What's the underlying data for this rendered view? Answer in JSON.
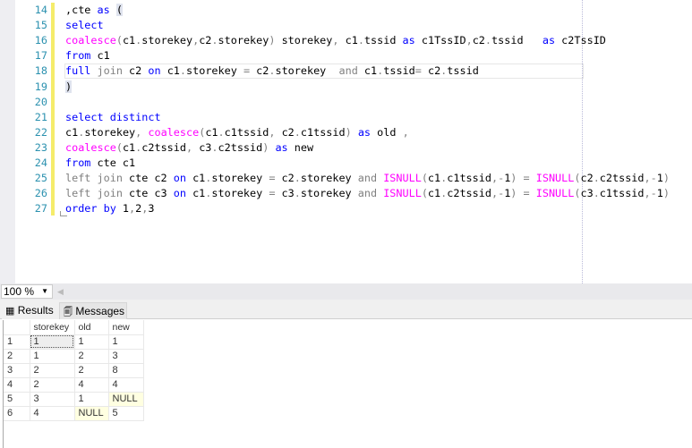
{
  "editor": {
    "lines": [
      {
        "n": "14",
        "tokens": [
          [
            "p",
            ",cte "
          ],
          [
            "k",
            "as"
          ],
          [
            "p",
            " "
          ],
          [
            "h",
            "("
          ]
        ]
      },
      {
        "n": "15",
        "tokens": [
          [
            "k",
            "select"
          ]
        ]
      },
      {
        "n": "16",
        "tokens": [
          [
            "f",
            "coalesce"
          ],
          [
            "g",
            "("
          ],
          [
            "p",
            "c1"
          ],
          [
            "g",
            "."
          ],
          [
            "p",
            "storekey"
          ],
          [
            "g",
            ","
          ],
          [
            "p",
            "c2"
          ],
          [
            "g",
            "."
          ],
          [
            "p",
            "storekey"
          ],
          [
            "g",
            ")"
          ],
          [
            "p",
            " storekey"
          ],
          [
            "g",
            ","
          ],
          [
            "p",
            " c1"
          ],
          [
            "g",
            "."
          ],
          [
            "p",
            "tssid "
          ],
          [
            "k",
            "as"
          ],
          [
            "p",
            " c1TssID"
          ],
          [
            "g",
            ","
          ],
          [
            "p",
            "c2"
          ],
          [
            "g",
            "."
          ],
          [
            "p",
            "tssid   "
          ],
          [
            "k",
            "as"
          ],
          [
            "p",
            " c2TssID"
          ]
        ]
      },
      {
        "n": "17",
        "tokens": [
          [
            "k",
            "from"
          ],
          [
            "p",
            " c1"
          ]
        ]
      },
      {
        "n": "18",
        "tokens": [
          [
            "k",
            "full"
          ],
          [
            "p",
            " "
          ],
          [
            "g",
            "join"
          ],
          [
            "p",
            " c2 "
          ],
          [
            "k",
            "on"
          ],
          [
            "p",
            " c1"
          ],
          [
            "g",
            "."
          ],
          [
            "p",
            "storekey "
          ],
          [
            "g",
            "="
          ],
          [
            "p",
            " c2"
          ],
          [
            "g",
            "."
          ],
          [
            "p",
            "storekey  "
          ],
          [
            "g",
            "and"
          ],
          [
            "p",
            " c1"
          ],
          [
            "g",
            "."
          ],
          [
            "p",
            "tssid"
          ],
          [
            "g",
            "="
          ],
          [
            "p",
            " c2"
          ],
          [
            "g",
            "."
          ],
          [
            "p",
            "tssid"
          ]
        ]
      },
      {
        "n": "19",
        "tokens": [
          [
            "h",
            ")"
          ]
        ]
      },
      {
        "n": "20",
        "tokens": []
      },
      {
        "n": "21",
        "tokens": [
          [
            "k",
            "select"
          ],
          [
            "p",
            " "
          ],
          [
            "k",
            "distinct"
          ]
        ]
      },
      {
        "n": "22",
        "tokens": [
          [
            "p",
            "c1"
          ],
          [
            "g",
            "."
          ],
          [
            "p",
            "storekey"
          ],
          [
            "g",
            ","
          ],
          [
            "p",
            " "
          ],
          [
            "f",
            "coalesce"
          ],
          [
            "g",
            "("
          ],
          [
            "p",
            "c1"
          ],
          [
            "g",
            "."
          ],
          [
            "p",
            "c1tssid"
          ],
          [
            "g",
            ","
          ],
          [
            "p",
            " c2"
          ],
          [
            "g",
            "."
          ],
          [
            "p",
            "c1tssid"
          ],
          [
            "g",
            ")"
          ],
          [
            "p",
            " "
          ],
          [
            "k",
            "as"
          ],
          [
            "p",
            " old "
          ],
          [
            "g",
            ","
          ]
        ]
      },
      {
        "n": "23",
        "tokens": [
          [
            "f",
            "coalesce"
          ],
          [
            "g",
            "("
          ],
          [
            "p",
            "c1"
          ],
          [
            "g",
            "."
          ],
          [
            "p",
            "c2tssid"
          ],
          [
            "g",
            ","
          ],
          [
            "p",
            " c3"
          ],
          [
            "g",
            "."
          ],
          [
            "p",
            "c2tssid"
          ],
          [
            "g",
            ")"
          ],
          [
            "p",
            " "
          ],
          [
            "k",
            "as"
          ],
          [
            "p",
            " new"
          ]
        ]
      },
      {
        "n": "24",
        "tokens": [
          [
            "k",
            "from"
          ],
          [
            "p",
            " cte c1"
          ]
        ]
      },
      {
        "n": "25",
        "tokens": [
          [
            "g",
            "left join"
          ],
          [
            "p",
            " cte c2 "
          ],
          [
            "k",
            "on"
          ],
          [
            "p",
            " c1"
          ],
          [
            "g",
            "."
          ],
          [
            "p",
            "storekey "
          ],
          [
            "g",
            "="
          ],
          [
            "p",
            " c2"
          ],
          [
            "g",
            "."
          ],
          [
            "p",
            "storekey "
          ],
          [
            "g",
            "and"
          ],
          [
            "p",
            " "
          ],
          [
            "f",
            "ISNULL"
          ],
          [
            "g",
            "("
          ],
          [
            "p",
            "c1"
          ],
          [
            "g",
            "."
          ],
          [
            "p",
            "c1tssid"
          ],
          [
            "g",
            ",-"
          ],
          [
            "p",
            "1"
          ],
          [
            "g",
            ")"
          ],
          [
            "p",
            " "
          ],
          [
            "g",
            "="
          ],
          [
            "p",
            " "
          ],
          [
            "f",
            "ISNULL"
          ],
          [
            "g",
            "("
          ],
          [
            "p",
            "c2"
          ],
          [
            "g",
            "."
          ],
          [
            "p",
            "c2tssid"
          ],
          [
            "g",
            ",-"
          ],
          [
            "p",
            "1"
          ],
          [
            "g",
            ")"
          ]
        ]
      },
      {
        "n": "26",
        "tokens": [
          [
            "g",
            "left join"
          ],
          [
            "p",
            " cte c3 "
          ],
          [
            "k",
            "on"
          ],
          [
            "p",
            " c1"
          ],
          [
            "g",
            "."
          ],
          [
            "p",
            "storekey "
          ],
          [
            "g",
            "="
          ],
          [
            "p",
            " c3"
          ],
          [
            "g",
            "."
          ],
          [
            "p",
            "storekey "
          ],
          [
            "g",
            "and"
          ],
          [
            "p",
            " "
          ],
          [
            "f",
            "ISNULL"
          ],
          [
            "g",
            "("
          ],
          [
            "p",
            "c1"
          ],
          [
            "g",
            "."
          ],
          [
            "p",
            "c2tssid"
          ],
          [
            "g",
            ",-"
          ],
          [
            "p",
            "1"
          ],
          [
            "g",
            ")"
          ],
          [
            "p",
            " "
          ],
          [
            "g",
            "="
          ],
          [
            "p",
            " "
          ],
          [
            "f",
            "ISNULL"
          ],
          [
            "g",
            "("
          ],
          [
            "p",
            "c3"
          ],
          [
            "g",
            "."
          ],
          [
            "p",
            "c1tssid"
          ],
          [
            "g",
            ",-"
          ],
          [
            "p",
            "1"
          ],
          [
            "g",
            ")"
          ]
        ]
      },
      {
        "n": "27",
        "tokens": [
          [
            "k",
            "order by"
          ],
          [
            "p",
            " 1"
          ],
          [
            "g",
            ","
          ],
          [
            "p",
            "2"
          ],
          [
            "g",
            ","
          ],
          [
            "p",
            "3"
          ]
        ]
      }
    ]
  },
  "zoom": {
    "value": "100 %"
  },
  "tabs": {
    "results": "Results",
    "messages": "Messages"
  },
  "results": {
    "columns": [
      "storekey",
      "old",
      "new"
    ],
    "rows": [
      {
        "n": "1",
        "cells": [
          "1",
          "1",
          "1"
        ]
      },
      {
        "n": "2",
        "cells": [
          "1",
          "2",
          "3"
        ]
      },
      {
        "n": "3",
        "cells": [
          "2",
          "2",
          "8"
        ]
      },
      {
        "n": "4",
        "cells": [
          "2",
          "4",
          "4"
        ]
      },
      {
        "n": "5",
        "cells": [
          "3",
          "1",
          "NULL"
        ]
      },
      {
        "n": "6",
        "cells": [
          "4",
          "NULL",
          "5"
        ]
      }
    ]
  }
}
